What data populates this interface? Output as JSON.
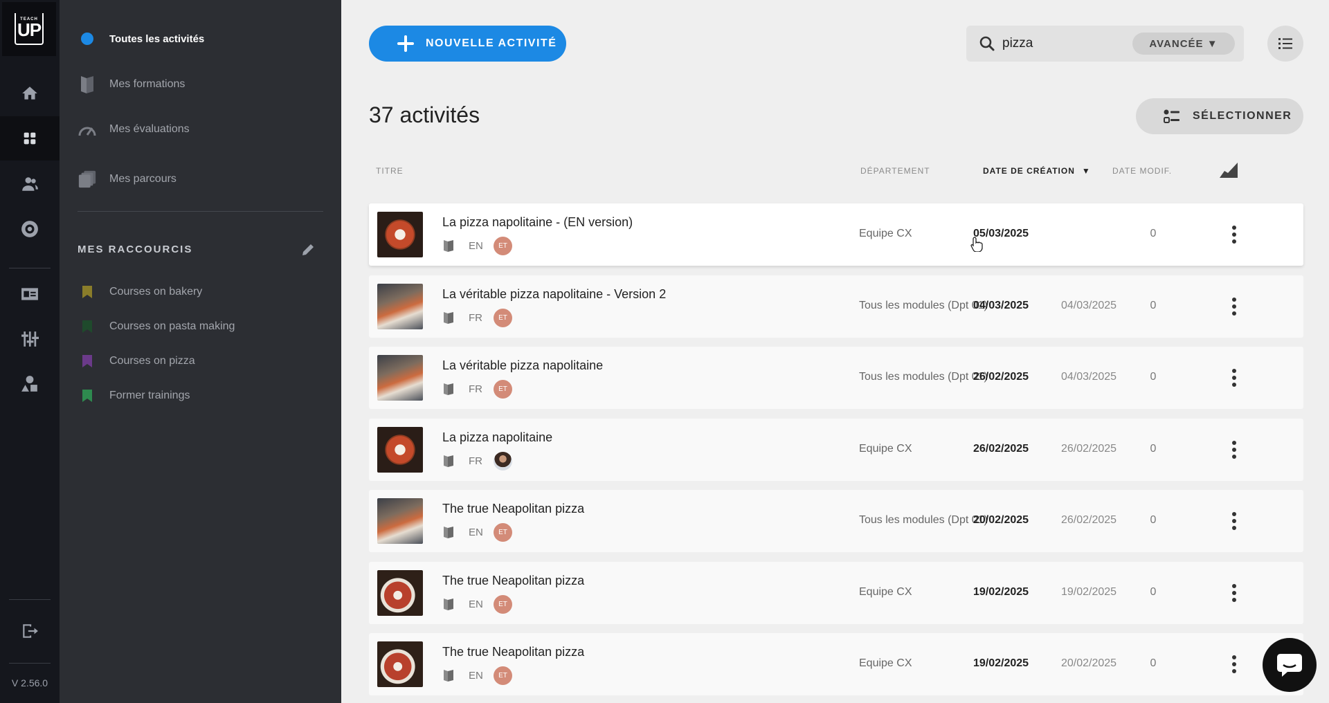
{
  "app": {
    "logo_top": "TEACH",
    "logo_main": "UP",
    "version": "V 2.56.0"
  },
  "rail": {
    "items": [
      {
        "icon": "home-icon"
      },
      {
        "icon": "dashboard-grid-icon",
        "active": true
      },
      {
        "icon": "users-icon"
      },
      {
        "icon": "support-lifebuoy-icon"
      },
      {
        "icon": "id-card-icon"
      },
      {
        "icon": "settings-sliders-icon"
      },
      {
        "icon": "shapes-icon"
      },
      {
        "icon": "logout-icon"
      }
    ]
  },
  "nav": {
    "items": [
      {
        "label": "Toutes les activités",
        "icon": "blue-dot-icon",
        "active": true
      },
      {
        "label": "Mes formations",
        "icon": "book-icon"
      },
      {
        "label": "Mes évaluations",
        "icon": "gauge-icon"
      },
      {
        "label": "Mes parcours",
        "icon": "stack-icon"
      }
    ],
    "shortcuts_title": "MES RACCOURCIS",
    "shortcuts": [
      {
        "label": "Courses on bakery",
        "color": "#8a7d2a"
      },
      {
        "label": "Courses on pasta making",
        "color": "#1f4a2c"
      },
      {
        "label": "Courses on pizza",
        "color": "#6b3a8a"
      },
      {
        "label": "Former trainings",
        "color": "#2e8a4f"
      }
    ]
  },
  "toolbar": {
    "new_activity_label": "NOUVELLE ACTIVITÉ",
    "search_value": "pizza",
    "advanced_label": "AVANCÉE ▼",
    "select_label": "SÉLECTIONNER"
  },
  "list": {
    "count_label": "37 activités",
    "headers": {
      "title": "TITRE",
      "department": "DÉPARTEMENT",
      "created": "DATE DE CRÉATION",
      "modified": "DATE MODIF."
    },
    "rows": [
      {
        "title": "La pizza napolitaine - (EN version)",
        "lang": "EN",
        "author": "ET",
        "department": "Equipe CX",
        "created": "05/03/2025",
        "modified": "",
        "views": "0"
      },
      {
        "title": "La véritable pizza napolitaine - Version 2",
        "lang": "FR",
        "author": "ET",
        "department": "Tous les modules (Dpt 01)",
        "created": "04/03/2025",
        "modified": "04/03/2025",
        "views": "0"
      },
      {
        "title": "La véritable pizza napolitaine",
        "lang": "FR",
        "author": "ET",
        "department": "Tous les modules (Dpt 01)",
        "created": "26/02/2025",
        "modified": "04/03/2025",
        "views": "0"
      },
      {
        "title": "La pizza napolitaine",
        "lang": "FR",
        "author": "",
        "department": "Equipe CX",
        "created": "26/02/2025",
        "modified": "26/02/2025",
        "views": "0"
      },
      {
        "title": "The true Neapolitan pizza",
        "lang": "EN",
        "author": "ET",
        "department": "Tous les modules (Dpt 01)",
        "created": "20/02/2025",
        "modified": "26/02/2025",
        "views": "0"
      },
      {
        "title": "The true Neapolitan pizza",
        "lang": "EN",
        "author": "ET",
        "department": "Equipe CX",
        "created": "19/02/2025",
        "modified": "19/02/2025",
        "views": "0"
      },
      {
        "title": "The true Neapolitan pizza",
        "lang": "EN",
        "author": "ET",
        "department": "Equipe CX",
        "created": "19/02/2025",
        "modified": "20/02/2025",
        "views": "0"
      }
    ]
  },
  "colors": {
    "accent": "#1c89e4",
    "rail_bg": "#15171d",
    "nav_bg": "#2c2e33",
    "main_bg": "#efefef"
  }
}
